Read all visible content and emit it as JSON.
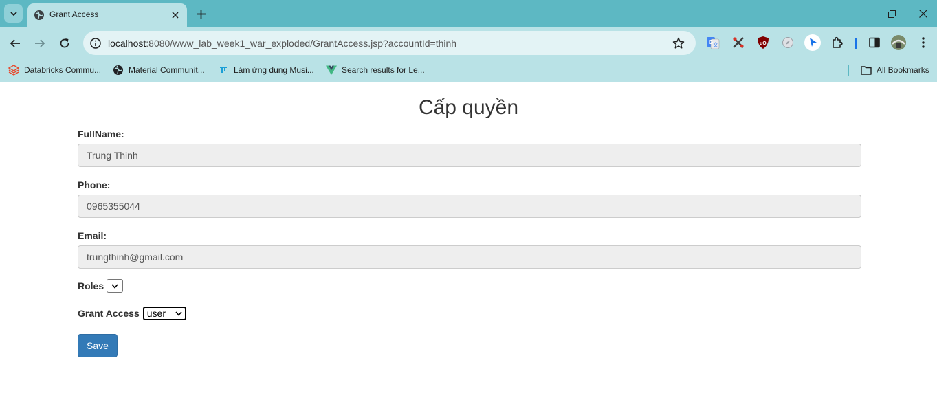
{
  "browser": {
    "tab_title": "Grant Access",
    "url_host": "localhost",
    "url_path": ":8080/www_lab_week1_war_exploded/GrantAccess.jsp?accountId=thinh",
    "bookmarks": [
      {
        "label": "Databricks Commu...",
        "icon": "databricks-icon"
      },
      {
        "label": "Material Communit...",
        "icon": "globe-icon"
      },
      {
        "label": "Làm ứng dụng Musi...",
        "icon": "tilde-icon"
      },
      {
        "label": "Search results for Le...",
        "icon": "vue-icon"
      }
    ],
    "all_bookmarks_label": "All Bookmarks"
  },
  "form": {
    "title": "Cấp quyền",
    "fullname_label": "FullName:",
    "fullname_value": "Trung Thinh",
    "phone_label": "Phone:",
    "phone_value": "0965355044",
    "email_label": "Email:",
    "email_value": "trungthinh@gmail.com",
    "roles_label": "Roles",
    "grant_access_label": "Grant Access",
    "grant_access_selected": "user",
    "save_label": "Save"
  },
  "colors": {
    "chrome_bg": "#5db8c3",
    "toolbar_bg": "#b9e2e6",
    "save_button": "#337ab7",
    "input_bg": "#eeeeee"
  }
}
